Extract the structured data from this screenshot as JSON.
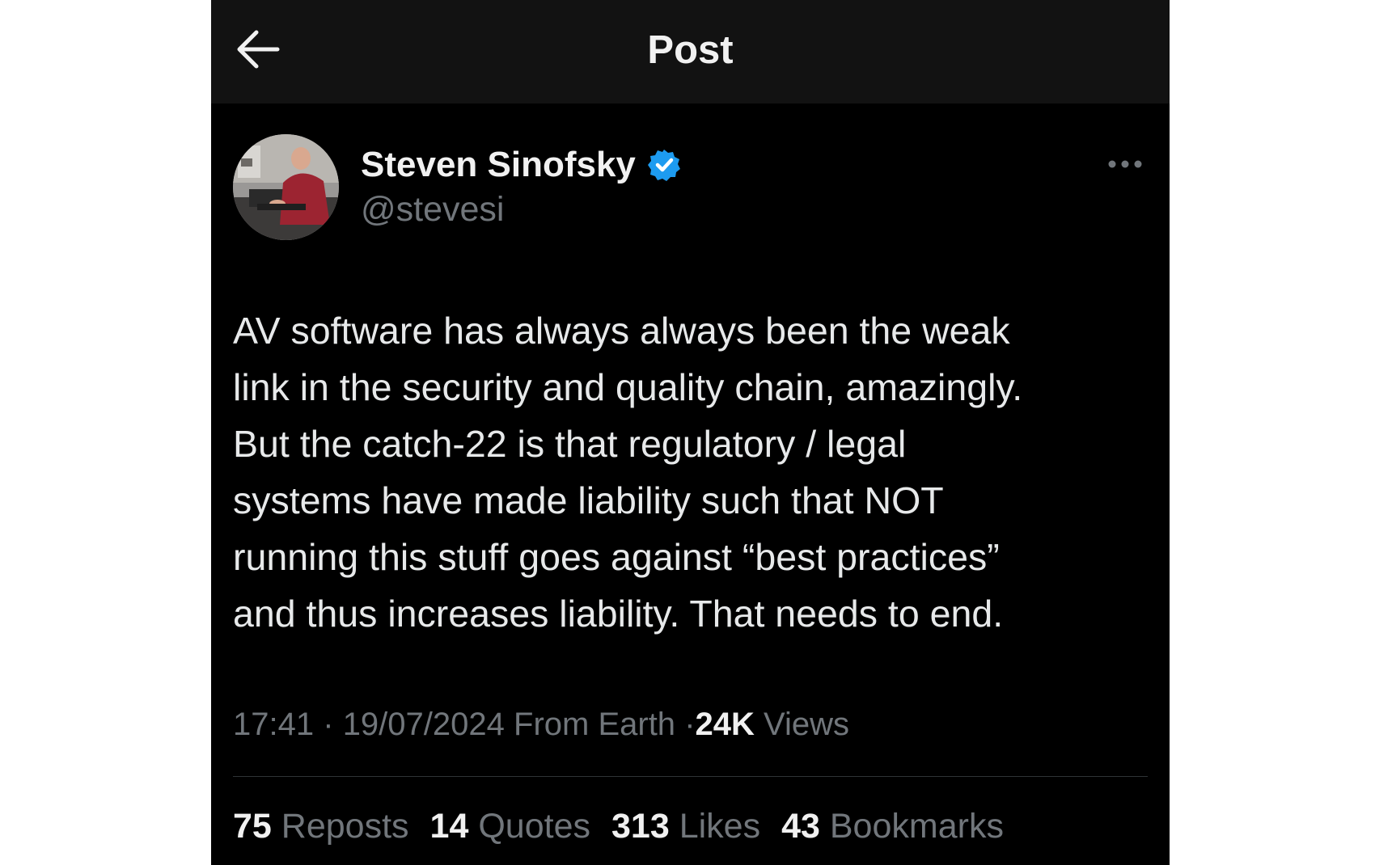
{
  "header": {
    "title": "Post",
    "back_icon": "arrow-left-icon"
  },
  "author": {
    "display_name": "Steven Sinofsky",
    "handle": "@stevesi",
    "verified_icon": "verified-badge-icon",
    "verified_color": "#1d9bf0",
    "more_icon": "more-horizontal-icon"
  },
  "post": {
    "text": "AV software has always always been the weak\nlink in the security and quality chain, amazingly.\nBut the catch-22 is that regulatory / legal\nsystems have made liability such that NOT\nrunning this stuff goes against “best practices”\nand thus increases liability. That needs to end.",
    "time": "17:41",
    "separator": "·",
    "date": "19/07/2024",
    "source": "From Earth",
    "views_count": "24K",
    "views_label": "Views"
  },
  "stats": [
    {
      "count": "75",
      "label": "Reposts"
    },
    {
      "count": "14",
      "label": "Quotes"
    },
    {
      "count": "313",
      "label": "Likes"
    },
    {
      "count": "43",
      "label": "Bookmarks"
    }
  ],
  "colors": {
    "background": "#000000",
    "header_background": "#121212",
    "text_primary": "#e7e9ea",
    "text_secondary": "#71767b",
    "accent": "#1d9bf0"
  }
}
